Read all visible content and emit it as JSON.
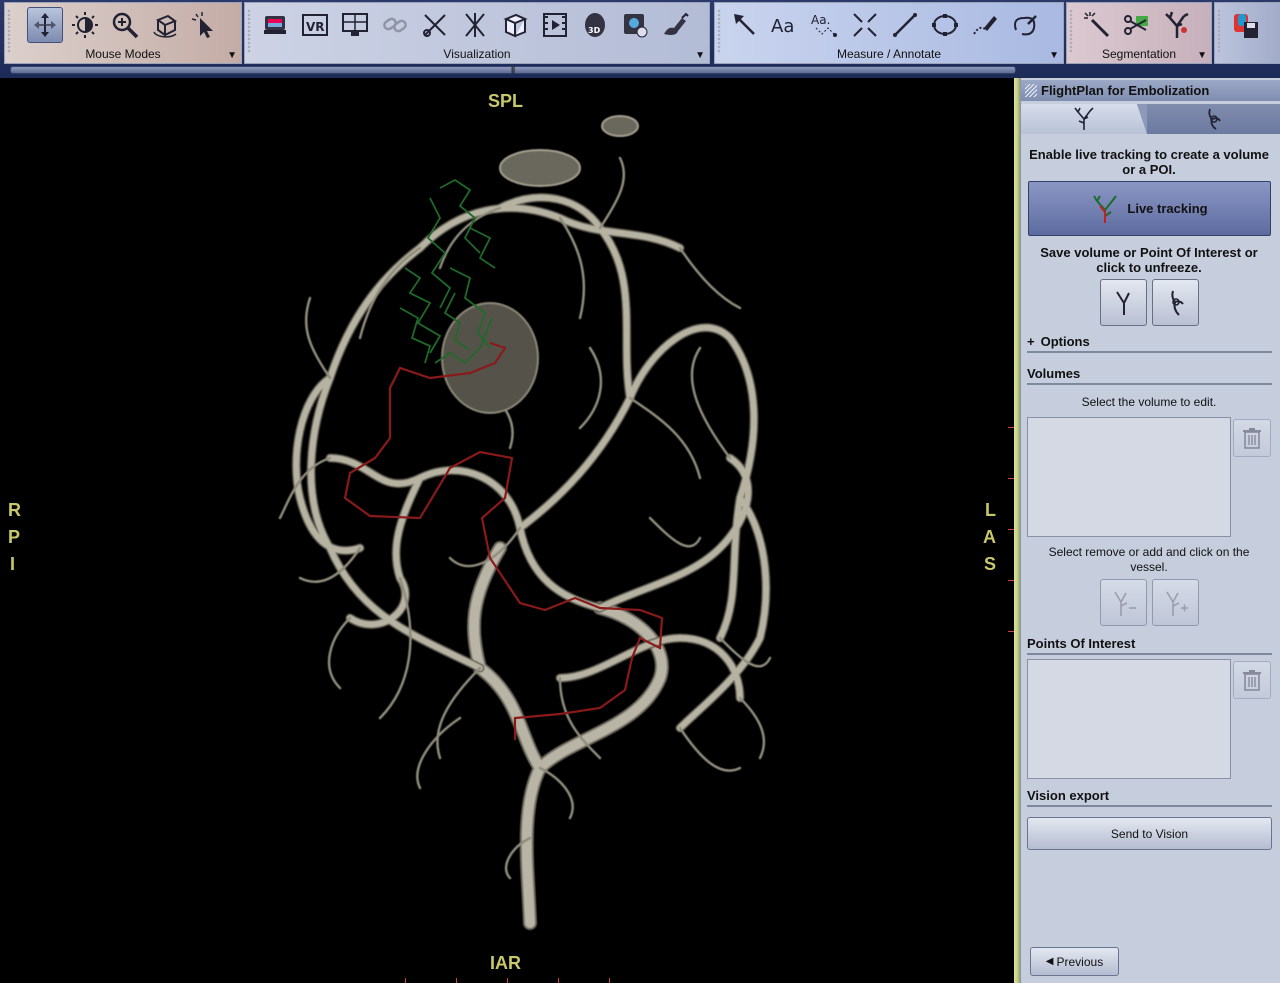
{
  "toolbar": {
    "groups": [
      {
        "label": "Mouse Modes",
        "color": "#c9b5b1",
        "icons": [
          "pan-move-icon",
          "window-level-icon",
          "zoom-icon",
          "rotate-3d-icon",
          "select-pointer-icon"
        ]
      },
      {
        "label": "Visualization",
        "color": "#bcc4dc",
        "icons": [
          "layout-viewer-icon",
          "vr-icon",
          "monitor-layout-icon",
          "link-icon",
          "crosshair-scissors-icon",
          "cut-plane-icon",
          "box-clip-icon",
          "cine-film-icon",
          "3d-volume-icon",
          "camera-snapshot-icon",
          "brush-paint-icon"
        ]
      },
      {
        "label": "Measure / Annotate",
        "color": "#b9c9ea",
        "icons": [
          "arrow-annotation-icon",
          "text-annotation-icon",
          "text-leader-icon",
          "cross-cursor-icon",
          "line-measure-icon",
          "ellipse-roi-icon",
          "freehand-pencil-icon",
          "curve-lasso-icon"
        ]
      },
      {
        "label": "Segmentation",
        "color": "#d3bfc7",
        "icons": [
          "magic-wand-icon",
          "scissors-segment-icon",
          "vessel-segment-icon"
        ]
      }
    ],
    "save_icon": "save-disk-icon"
  },
  "viewer": {
    "orientation": {
      "top": "SPL",
      "bottom": "IAR",
      "left": [
        "R",
        "P",
        "I"
      ],
      "right": [
        "L",
        "A",
        "S"
      ]
    }
  },
  "panel": {
    "title": "FlightPlan for Embolization",
    "tabs": [
      "vessel-tree-icon",
      "poi-tab-icon"
    ],
    "instruction": "Enable live tracking to create a volume or a POI.",
    "live_tracking_label": "Live tracking",
    "save_instruction": "Save volume or Point Of Interest or click to unfreeze.",
    "options_label": "Options",
    "volumes": {
      "title": "Volumes",
      "hint": "Select the volume to edit.",
      "edit_hint": "Select remove or add and click on the vessel."
    },
    "poi": {
      "title": "Points Of Interest"
    },
    "vision_export": {
      "title": "Vision export",
      "button_label": "Send to Vision"
    },
    "previous_label": "Previous"
  },
  "colors": {
    "track_red": "#8a1a1a",
    "track_green": "#1f6a2a",
    "orientation_text": "#c8c86a"
  }
}
